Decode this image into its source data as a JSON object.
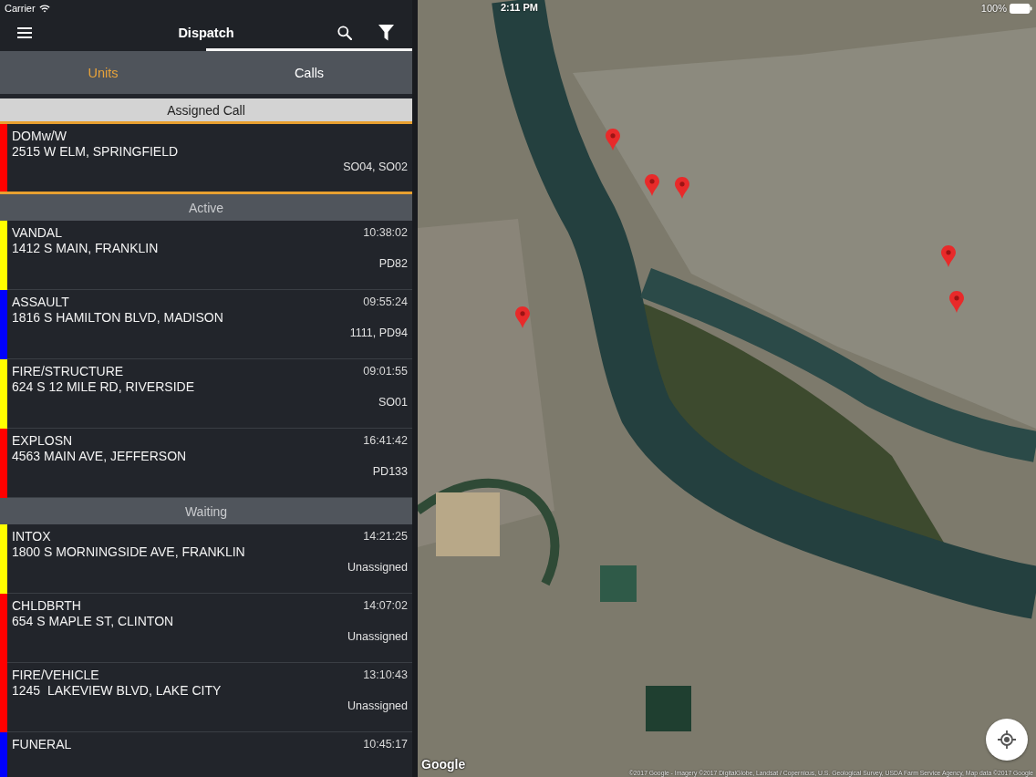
{
  "status_bar": {
    "carrier": "Carrier",
    "time": "2:11 PM",
    "battery": "100%"
  },
  "header": {
    "title": "Dispatch"
  },
  "tabs": [
    {
      "label": "Units",
      "selected": false,
      "highlighted": true
    },
    {
      "label": "Calls",
      "selected": true,
      "highlighted": false
    }
  ],
  "sections": [
    {
      "title": "Assigned Call",
      "kind": "assigned",
      "calls": [
        {
          "title": "DOMw/W",
          "address": "2515 W ELM, SPRINGFIELD",
          "units": "SO04, SO02",
          "color": "#ff0000"
        }
      ]
    },
    {
      "title": "Active",
      "kind": "status",
      "calls": [
        {
          "title": "VANDAL",
          "address": "1412 S MAIN, FRANKLIN",
          "time": "10:38:02",
          "units": "PD82",
          "color": "#ffff00"
        },
        {
          "title": "ASSAULT",
          "address": "1816 S HAMILTON BLVD, MADISON",
          "time": "09:55:24",
          "units": "1111, PD94",
          "color": "#0000ff"
        },
        {
          "title": "FIRE/STRUCTURE",
          "address": "624 S 12 MILE RD, RIVERSIDE",
          "time": "09:01:55",
          "units": "SO01",
          "color": "#ffff00"
        },
        {
          "title": "EXPLOSN",
          "address": "4563 MAIN AVE, JEFFERSON",
          "time": "16:41:42",
          "units": "PD133",
          "color": "#ff0000"
        }
      ]
    },
    {
      "title": "Waiting",
      "kind": "status",
      "calls": [
        {
          "title": "INTOX",
          "address": "1800 S MORNINGSIDE AVE, FRANKLIN",
          "time": "14:21:25",
          "units": "Unassigned",
          "color": "#ffff00"
        },
        {
          "title": "CHLDBRTH",
          "address": "654 S MAPLE ST, CLINTON",
          "time": "14:07:02",
          "units": "Unassigned",
          "color": "#ff0000"
        },
        {
          "title": "FIRE/VEHICLE",
          "address": "1245  LAKEVIEW BLVD, LAKE CITY",
          "time": "13:10:43",
          "units": "Unassigned",
          "color": "#ff0000"
        },
        {
          "title": "FUNERAL",
          "time": "10:45:17",
          "color": "#0000ff"
        }
      ]
    }
  ],
  "map": {
    "logo": "Google",
    "attribution": "©2017 Google - Imagery ©2017 DigitalGlobe, Landsat / Copernicus, U.S. Geological Survey, USDA Farm Service Agency, Map data ©2017 Google"
  }
}
